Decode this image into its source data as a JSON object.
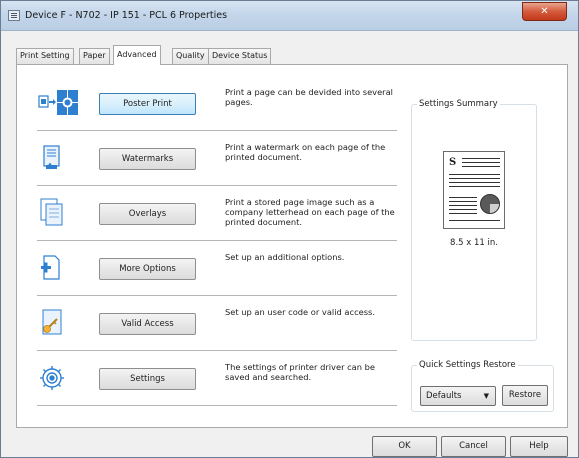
{
  "window": {
    "title": "Device F - N702 - IP 151 - PCL 6 Properties",
    "close_glyph": "✕"
  },
  "tabs": [
    {
      "label": "Print Setting",
      "active": false
    },
    {
      "label": "Paper",
      "active": false
    },
    {
      "label": "Advanced",
      "active": true
    },
    {
      "label": "Quality",
      "active": false
    },
    {
      "label": "Device Status",
      "active": false
    }
  ],
  "rows": [
    {
      "icon": "poster-print-icon",
      "button": "Poster Print",
      "desc": "Print a page can be devided into several pages."
    },
    {
      "icon": "watermarks-icon",
      "button": "Watermarks",
      "desc": "Print a watermark on each page of the printed document."
    },
    {
      "icon": "overlays-icon",
      "button": "Overlays",
      "desc": "Print a stored page image such as a company letterhead on each page of the printed document."
    },
    {
      "icon": "more-options-icon",
      "button": "More Options",
      "desc": "Set up an additional options."
    },
    {
      "icon": "key-icon",
      "button": "Valid Access",
      "desc": "Set up an user code or valid access."
    },
    {
      "icon": "gear-icon",
      "button": "Settings",
      "desc": "The settings of printer driver can be saved and searched."
    }
  ],
  "summary": {
    "legend": "Settings Summary",
    "page_glyph": "S",
    "size": "8.5 x 11 in."
  },
  "quick_restore": {
    "legend": "Quick Settings Restore",
    "selected": "Defaults",
    "restore_label": "Restore"
  },
  "footer": {
    "ok": "OK",
    "cancel": "Cancel",
    "help": "Help"
  },
  "colors": {
    "focus_border": "#3c7fb1",
    "close_red": "#c3391a",
    "icon_blue": "#2f7fd1"
  }
}
